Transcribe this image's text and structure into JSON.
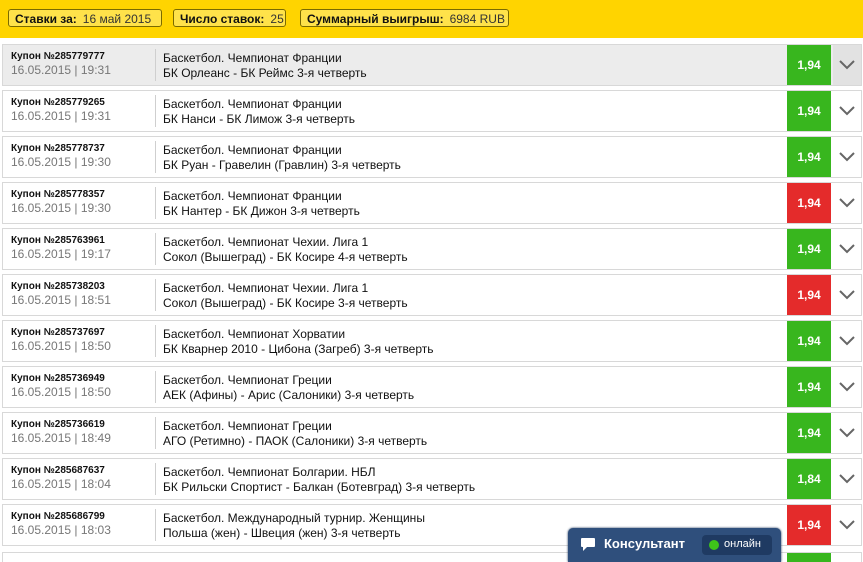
{
  "header": {
    "bets_for_label": "Ставки за:",
    "bets_for_value": "16 май 2015",
    "count_label": "Число ставок:",
    "count_value": "25",
    "total_label": "Суммарный выигрыш:",
    "total_value": "6984 RUB"
  },
  "colors": {
    "header_bg": "#ffd400",
    "win": "#38b61e",
    "lose": "#e42b2b",
    "consultant_bg": "#2f4f7c"
  },
  "bets": [
    {
      "coupon": "Купон №285779777",
      "datetime": "16.05.2015 | 19:31",
      "league": "Баскетбол. Чемпионат Франции",
      "match": "БК Орлеанс - БК Реймс 3-я четверть",
      "odds": "1,94",
      "result": "win"
    },
    {
      "coupon": "Купон №285779265",
      "datetime": "16.05.2015 | 19:31",
      "league": "Баскетбол. Чемпионат Франции",
      "match": "БК Нанси - БК Лимож 3-я четверть",
      "odds": "1,94",
      "result": "win"
    },
    {
      "coupon": "Купон №285778737",
      "datetime": "16.05.2015 | 19:30",
      "league": "Баскетбол. Чемпионат Франции",
      "match": "БК Руан - Гравелин (Гравлин) 3-я четверть",
      "odds": "1,94",
      "result": "win"
    },
    {
      "coupon": "Купон №285778357",
      "datetime": "16.05.2015 | 19:30",
      "league": "Баскетбол. Чемпионат Франции",
      "match": "БК Нантер - БК Дижон 3-я четверть",
      "odds": "1,94",
      "result": "lose"
    },
    {
      "coupon": "Купон №285763961",
      "datetime": "16.05.2015 | 19:17",
      "league": "Баскетбол. Чемпионат Чехии. Лига 1",
      "match": "Сокол (Вышеград) - БК Косире 4-я четверть",
      "odds": "1,94",
      "result": "win"
    },
    {
      "coupon": "Купон №285738203",
      "datetime": "16.05.2015 | 18:51",
      "league": "Баскетбол. Чемпионат Чехии. Лига 1",
      "match": "Сокол (Вышеград) - БК Косире 3-я четверть",
      "odds": "1,94",
      "result": "lose"
    },
    {
      "coupon": "Купон №285737697",
      "datetime": "16.05.2015 | 18:50",
      "league": "Баскетбол. Чемпионат Хорватии",
      "match": "БК Кварнер 2010 - Цибона (Загреб) 3-я четверть",
      "odds": "1,94",
      "result": "win"
    },
    {
      "coupon": "Купон №285736949",
      "datetime": "16.05.2015 | 18:50",
      "league": "Баскетбол. Чемпионат Греции",
      "match": "АЕК (Афины) - Арис (Салоники) 3-я четверть",
      "odds": "1,94",
      "result": "win"
    },
    {
      "coupon": "Купон №285736619",
      "datetime": "16.05.2015 | 18:49",
      "league": "Баскетбол. Чемпионат Греции",
      "match": "АГО (Ретимно) - ПАОК (Салоники) 3-я четверть",
      "odds": "1,94",
      "result": "win"
    },
    {
      "coupon": "Купон №285687637",
      "datetime": "16.05.2015 | 18:04",
      "league": "Баскетбол. Чемпионат Болгарии. НБЛ",
      "match": "БК Рильски Спортист - Балкан (Ботевград) 3-я четверть",
      "odds": "1,84",
      "result": "win"
    },
    {
      "coupon": "Купон №285686799",
      "datetime": "16.05.2015 | 18:03",
      "league": "Баскетбол. Международный турнир. Женщины",
      "match": "Польша (жен) - Швеция (жен) 3-я четверть",
      "odds": "1,94",
      "result": "lose"
    }
  ],
  "consultant": {
    "label": "Консультант",
    "status": "онлайн",
    "icon": "chat-bubble-icon"
  }
}
